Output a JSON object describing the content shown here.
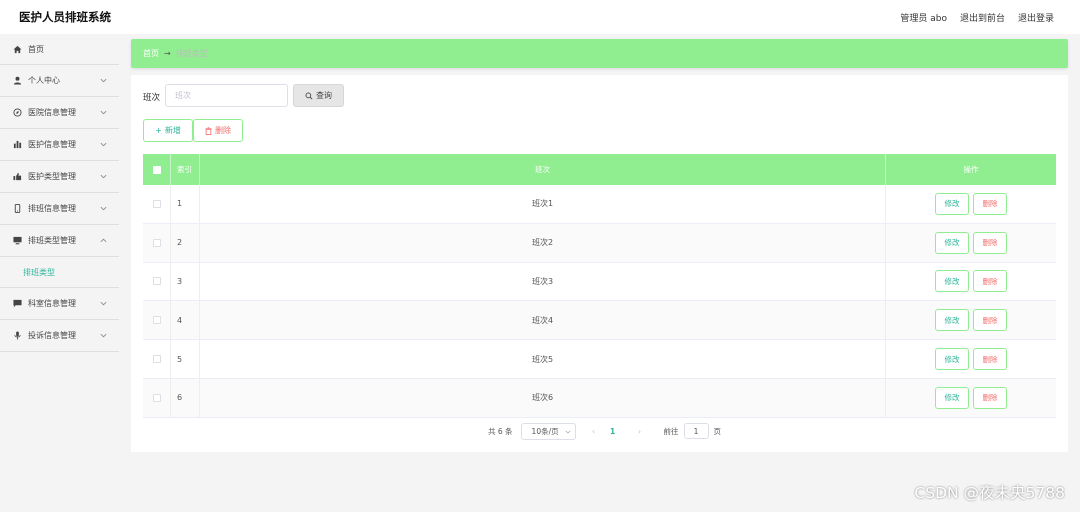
{
  "header": {
    "title": "医护人员排班系统",
    "user": "管理员 abo",
    "to_front": "退出到前台",
    "logout": "退出登录"
  },
  "sidebar": {
    "items": [
      {
        "label": "首页",
        "icon": "home-icon"
      },
      {
        "label": "个人中心",
        "icon": "user-icon"
      },
      {
        "label": "医院信息管理",
        "icon": "compass-icon"
      },
      {
        "label": "医护信息管理",
        "icon": "chart-icon"
      },
      {
        "label": "医护类型管理",
        "icon": "thumb-icon"
      },
      {
        "label": "排班信息管理",
        "icon": "phone-icon"
      },
      {
        "label": "排班类型管理",
        "icon": "monitor-icon",
        "expanded": true
      },
      {
        "label": "科室信息管理",
        "icon": "message-icon"
      },
      {
        "label": "投诉信息管理",
        "icon": "mic-icon"
      }
    ],
    "submenu": {
      "label": "排班类型"
    }
  },
  "breadcrumb": {
    "home": "首页",
    "separator": "→",
    "current": "排班类型"
  },
  "search": {
    "label": "班次",
    "placeholder": "班次",
    "button": "查询"
  },
  "actions": {
    "add": "新增",
    "delete": "删除"
  },
  "table": {
    "headers": {
      "index": "索引",
      "name": "班次",
      "op": "操作"
    },
    "rows": [
      {
        "index": "1",
        "name": "班次1"
      },
      {
        "index": "2",
        "name": "班次2"
      },
      {
        "index": "3",
        "name": "班次3"
      },
      {
        "index": "4",
        "name": "班次4"
      },
      {
        "index": "5",
        "name": "班次5"
      },
      {
        "index": "6",
        "name": "班次6"
      }
    ],
    "edit_label": "修改",
    "delete_label": "删除"
  },
  "pagination": {
    "total": "共 6 条",
    "page_size": "10条/页",
    "prev": "‹",
    "current_page": "1",
    "next": "›",
    "goto_label": "前往",
    "goto_value": "1",
    "page_suffix": "页"
  },
  "watermark": "CSDN @夜未央5788",
  "colors": {
    "accent": "#90ee90",
    "teal": "#2bb49a",
    "danger": "#f56c6c"
  }
}
